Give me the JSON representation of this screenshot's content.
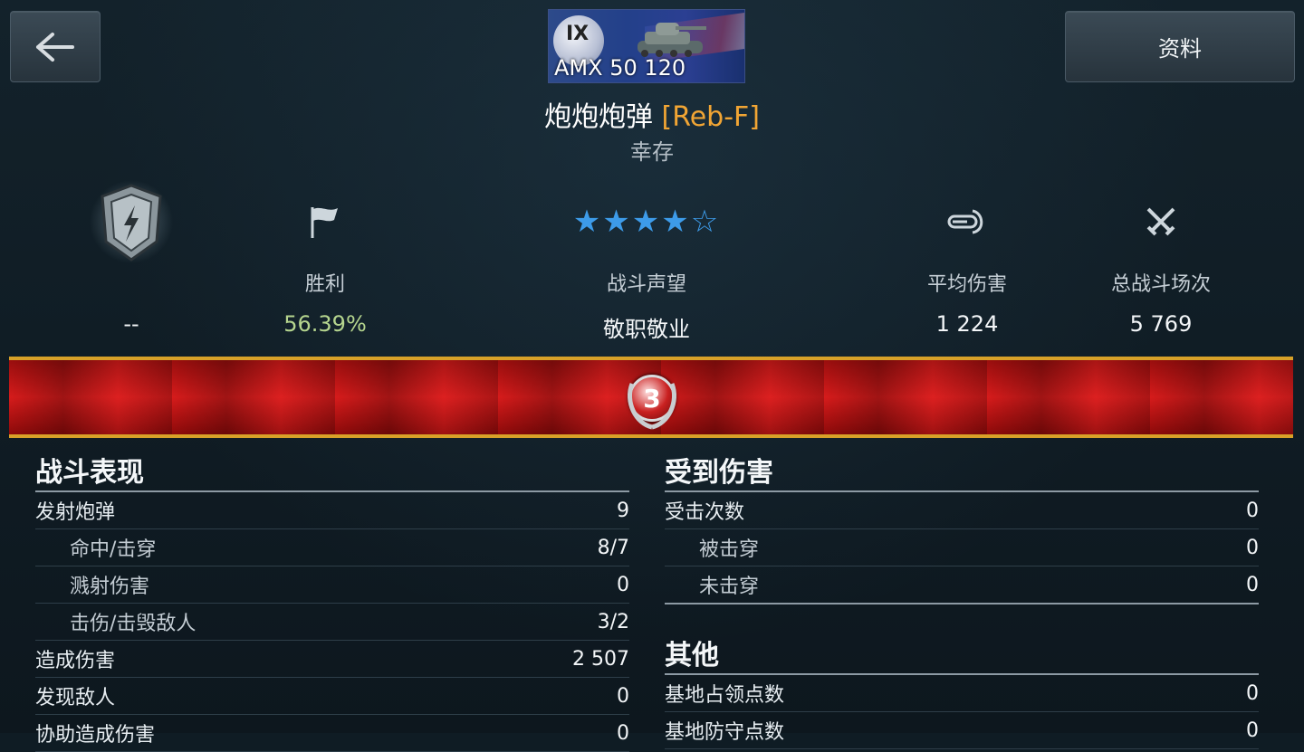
{
  "header": {
    "back_label": "←",
    "info_button": "资料"
  },
  "tank": {
    "tier": "IX",
    "name": "AMX 50 120"
  },
  "player": {
    "name": "炮炮炮弹",
    "clan": "[Reb-F]",
    "status": "幸存"
  },
  "stats": [
    {
      "label": "",
      "value": "--",
      "icon": "shield-icon"
    },
    {
      "label": "胜利",
      "value": "56.39%",
      "icon": "flag-icon"
    },
    {
      "label": "战斗声望",
      "value": "敬职敬业",
      "icon": "stars-rating",
      "rating": 4,
      "rating_max": 5
    },
    {
      "label": "平均伤害",
      "value": "1 224",
      "icon": "damage-icon"
    },
    {
      "label": "总战斗场次",
      "value": "5 769",
      "icon": "crossed-swords-icon"
    }
  ],
  "medal": {
    "rank": "3"
  },
  "combat": {
    "title": "战斗表现",
    "rows": [
      {
        "label": "发射炮弹",
        "value": "9",
        "sub": false
      },
      {
        "label": "命中/击穿",
        "value": "8/7",
        "sub": true
      },
      {
        "label": "溅射伤害",
        "value": "0",
        "sub": true
      },
      {
        "label": "击伤/击毁敌人",
        "value": "3/2",
        "sub": true
      },
      {
        "label": "造成伤害",
        "value": "2 507",
        "sub": false
      },
      {
        "label": "发现敌人",
        "value": "0",
        "sub": false
      },
      {
        "label": "协助造成伤害",
        "value": "0",
        "sub": false
      }
    ]
  },
  "received": {
    "title": "受到伤害",
    "rows": [
      {
        "label": "受击次数",
        "value": "0",
        "sub": false
      },
      {
        "label": "被击穿",
        "value": "0",
        "sub": true
      },
      {
        "label": "未击穿",
        "value": "0",
        "sub": true
      }
    ]
  },
  "other": {
    "title": "其他",
    "rows": [
      {
        "label": "基地占领点数",
        "value": "0",
        "sub": false
      },
      {
        "label": "基地防守点数",
        "value": "0",
        "sub": false
      }
    ]
  },
  "colors": {
    "clan": "#f1a534",
    "accent_star": "#3d9be9",
    "ribbon": "#d61b1b",
    "positive": "#b5d58e"
  }
}
